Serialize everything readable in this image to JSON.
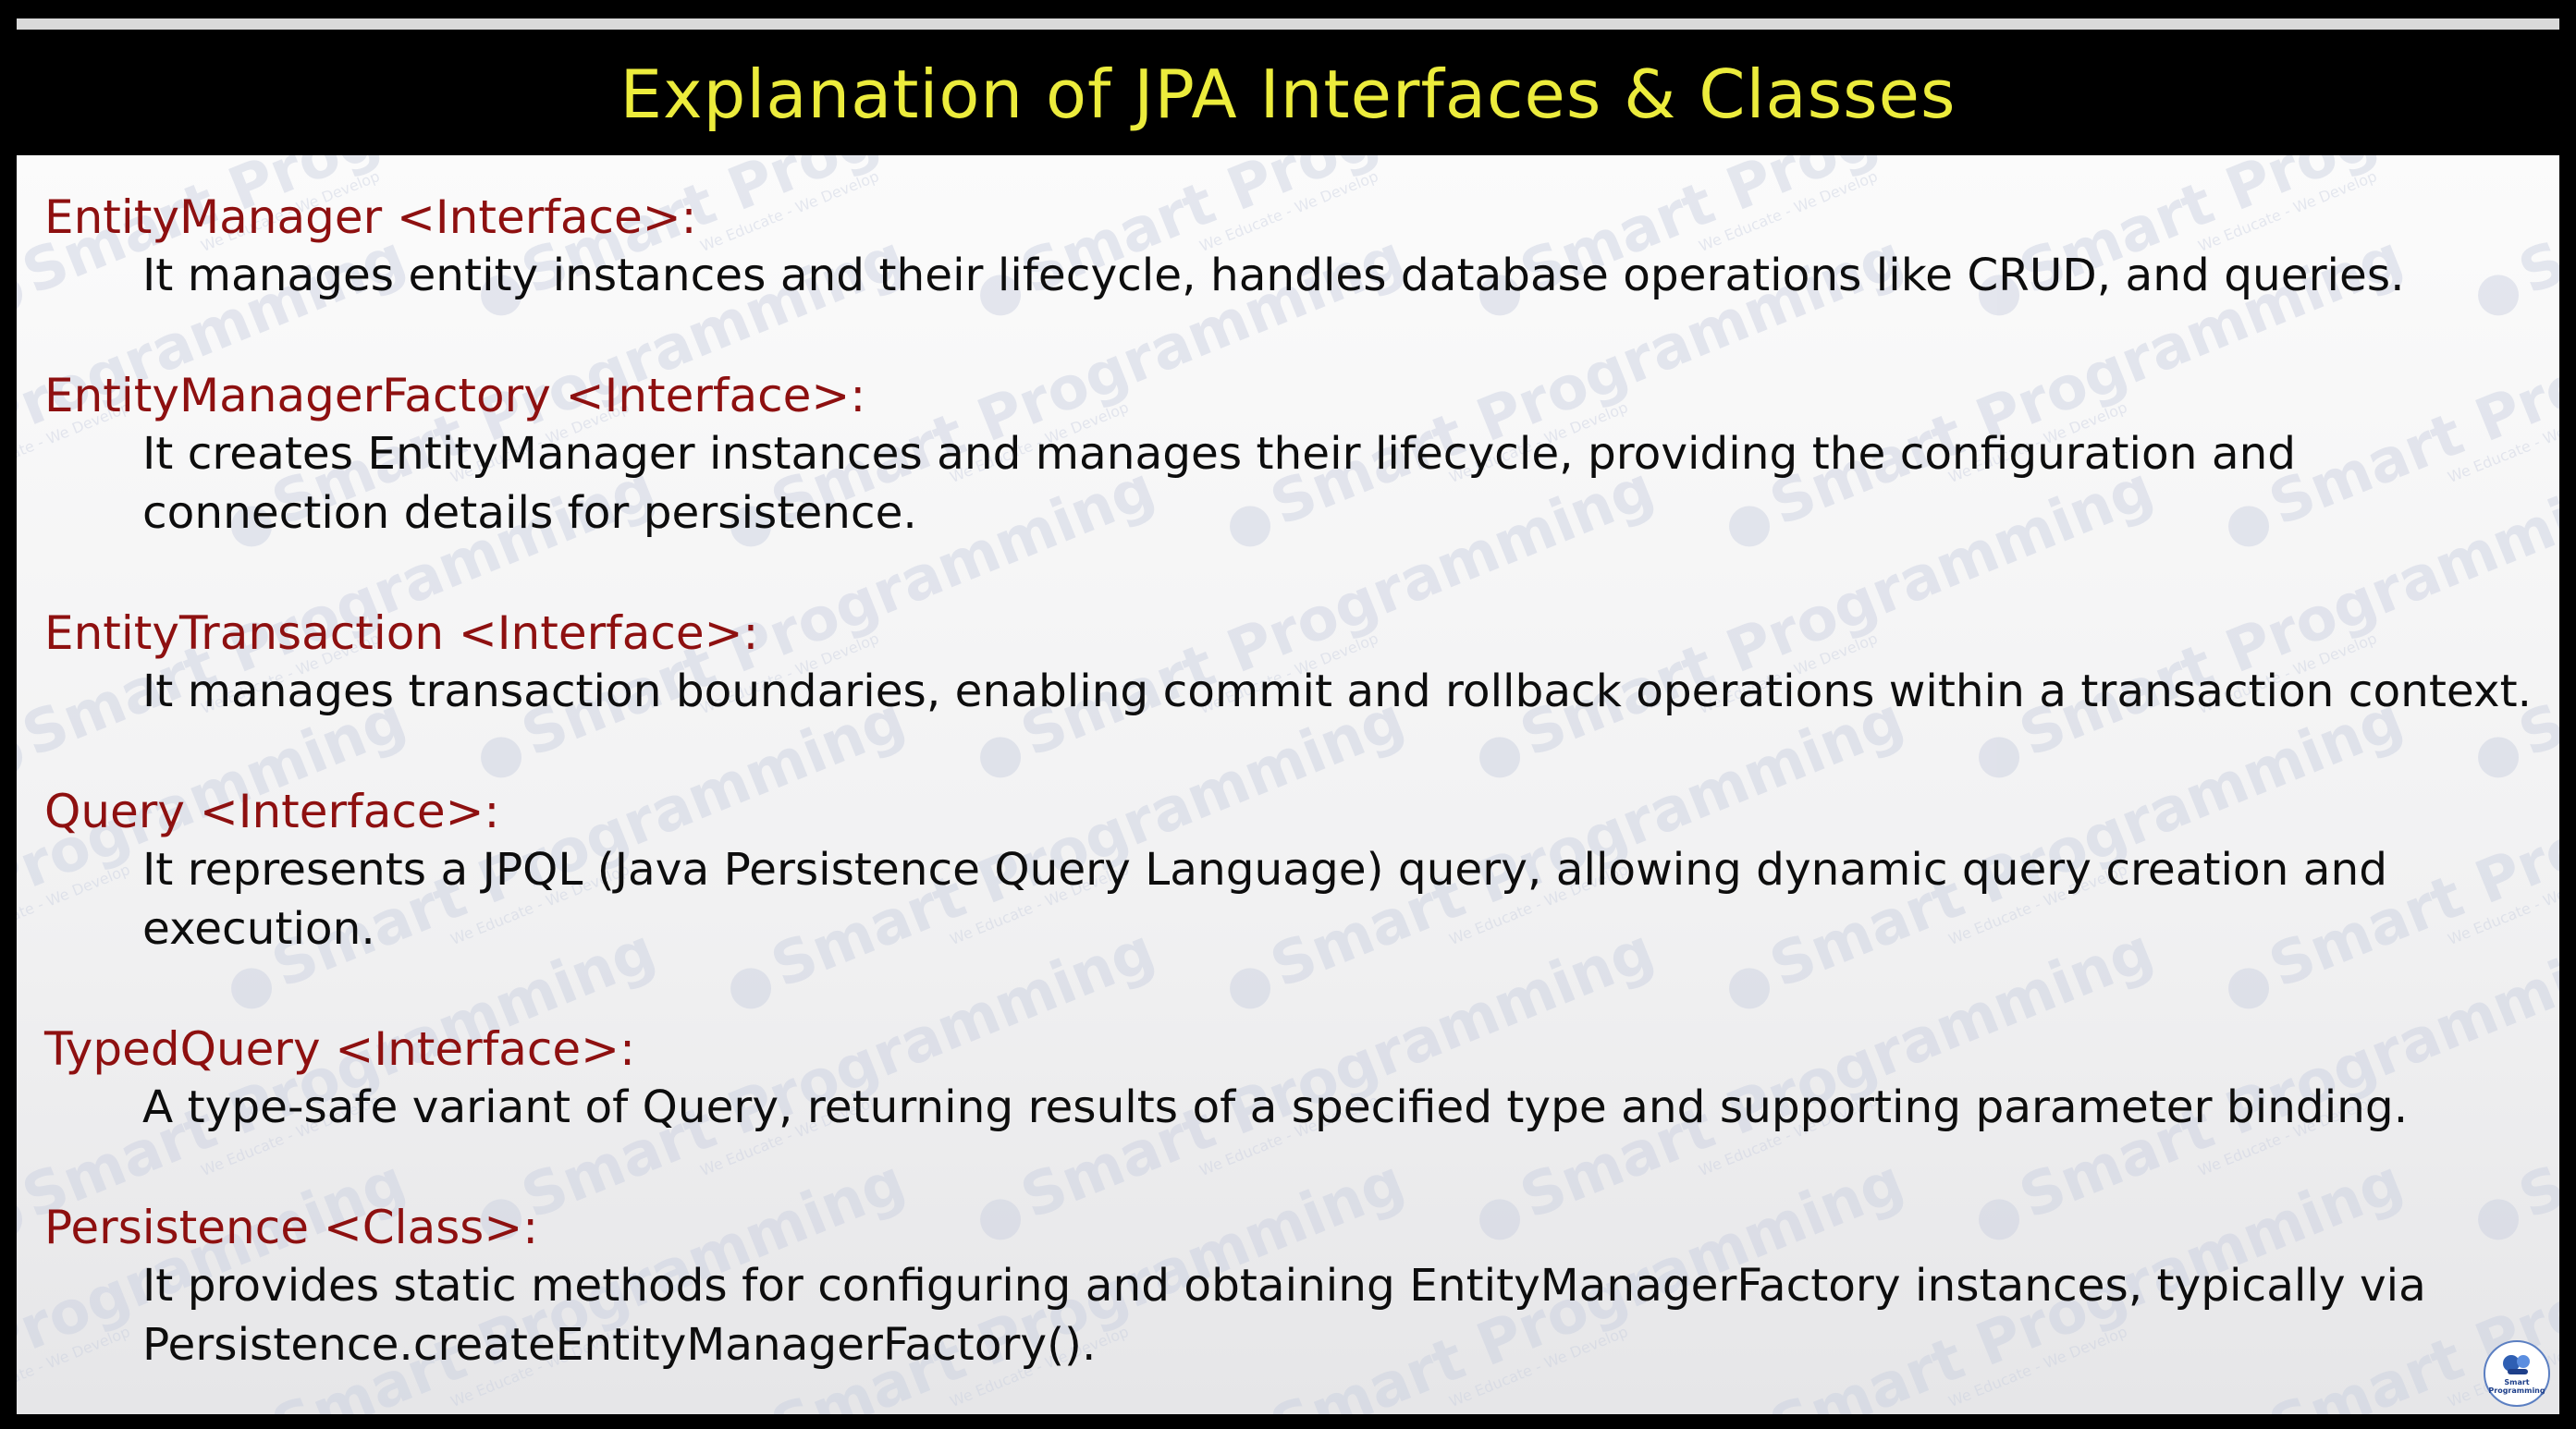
{
  "title": "Explanation of JPA Interfaces & Classes",
  "entries": [
    {
      "heading": "EntityManager <Interface>:",
      "description": "It manages entity instances and their lifecycle, handles database operations like CRUD, and queries."
    },
    {
      "heading": "EntityManagerFactory <Interface>:",
      "description": "It creates EntityManager instances and manages their lifecycle, providing the configuration and connection details for persistence."
    },
    {
      "heading": "EntityTransaction <Interface>:",
      "description": "It manages transaction boundaries, enabling commit and rollback operations within a transaction context."
    },
    {
      "heading": "Query <Interface>:",
      "description": "It represents a JPQL (Java Persistence Query Language) query, allowing dynamic query creation and execution."
    },
    {
      "heading": "TypedQuery <Interface>:",
      "description": "A type-safe variant of Query, returning results of a specified type and supporting parameter binding."
    },
    {
      "heading": "Persistence <Class>:",
      "description": "It provides static methods for configuring and obtaining EntityManagerFactory instances, typically via Persistence.createEntityManagerFactory()."
    }
  ],
  "watermark": {
    "text": "Smart Programming",
    "tagline": "We Educate - We Develop",
    "color": "#c9cfe0"
  },
  "logo": {
    "line1": "Smart",
    "line2": "Programming"
  },
  "colors": {
    "title": "#ecec3c",
    "heading": "#8e1010",
    "body": "#0d0d0d"
  }
}
